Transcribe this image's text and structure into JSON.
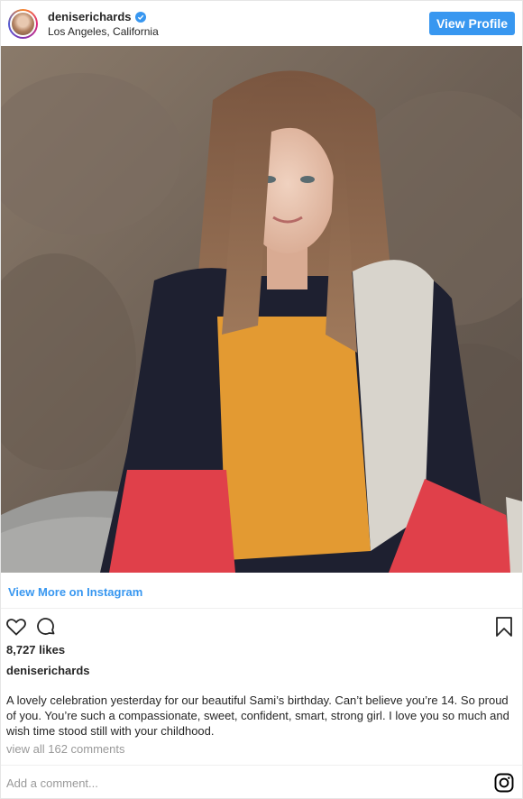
{
  "header": {
    "username": "deniserichards",
    "verified": true,
    "location": "Los Angeles, California",
    "view_profile_label": "View Profile"
  },
  "post": {
    "photo_subject": "photo-of-girl-in-colorblock-sweater",
    "view_more_label": "View More on Instagram",
    "likes": "8,727 likes",
    "caption_user": "deniserichards",
    "caption_text": "A lovely celebration yesterday for our beautiful Sami’s birthday. Can’t believe you’re 14. So proud of you. You’re such a compassionate, sweet, confident, smart, strong girl. I love you so much and wish time stood still with your childhood.",
    "view_comments_label": "view all 162 comments",
    "add_comment_placeholder": "Add a comment..."
  },
  "icons": {
    "like": "heart-icon",
    "comment": "comment-icon",
    "save": "bookmark-icon",
    "brand": "instagram-icon",
    "verified": "verified-badge-icon"
  },
  "colors": {
    "accent": "#3897f0",
    "text": "#262626",
    "muted": "#999999",
    "border": "#efefef"
  }
}
